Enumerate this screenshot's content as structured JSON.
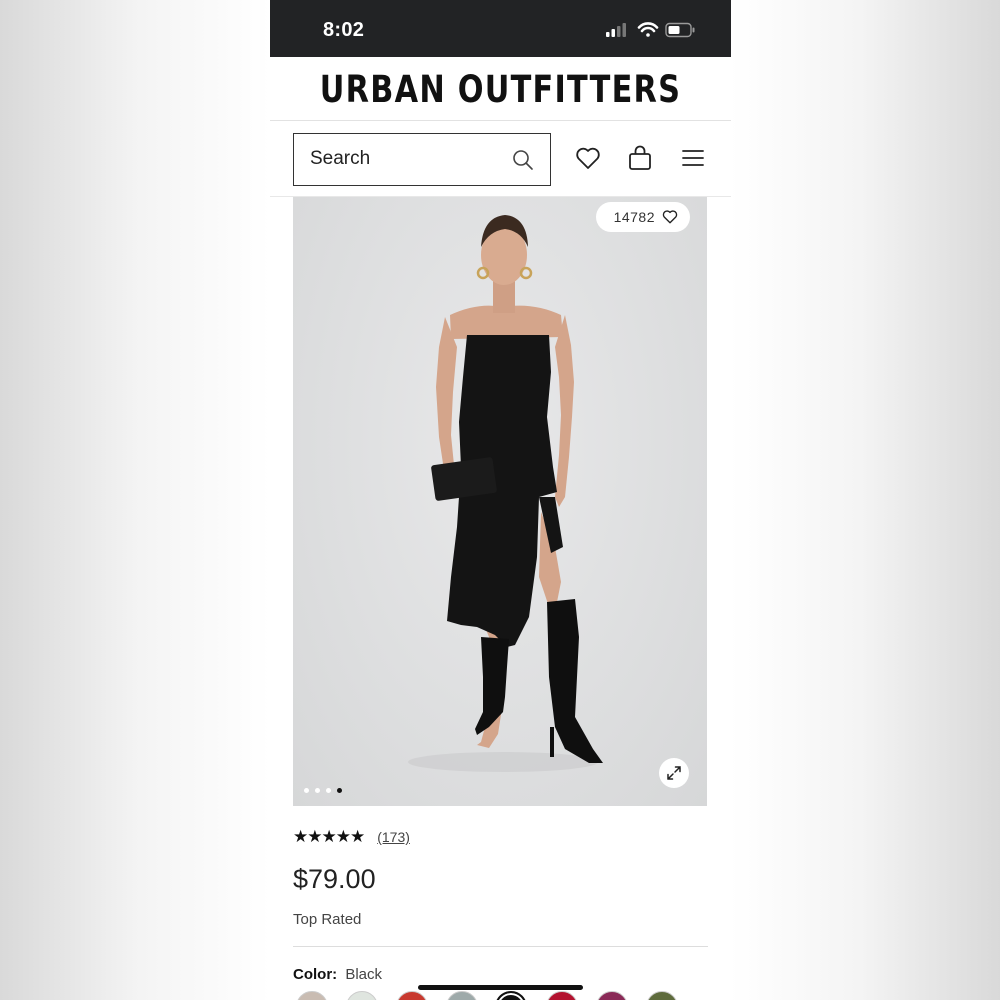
{
  "status_bar": {
    "time": "8:02",
    "icons": [
      "signal-icon",
      "wifi-icon",
      "battery-icon"
    ]
  },
  "header": {
    "brand": "URBAN OUTFITTERS"
  },
  "search": {
    "placeholder": "Search",
    "icon": "search-icon"
  },
  "header_actions": [
    "heart-icon",
    "bag-icon",
    "menu-icon"
  ],
  "product": {
    "likes": "14782",
    "image_count": 4,
    "active_image_index": 3,
    "rating": {
      "stars": "★★★★★",
      "score": 5,
      "count": "(173)"
    },
    "price": "$79.00",
    "badge": "Top Rated",
    "color_label": "Color:",
    "color_value": "Black"
  },
  "swatches": [
    {
      "name": "taupe",
      "color": "#c9bcb2"
    },
    {
      "name": "sage",
      "color": "#dfe5df"
    },
    {
      "name": "red-print",
      "color": "#c8392f"
    },
    {
      "name": "grey-blue",
      "color": "#9eaaaa"
    },
    {
      "name": "black",
      "color": "#111111",
      "selected": true
    },
    {
      "name": "crimson",
      "color": "#b3122f"
    },
    {
      "name": "plum",
      "color": "#8a2a57"
    },
    {
      "name": "olive",
      "color": "#5e6b3c"
    }
  ],
  "colors": {
    "status_bar_bg": "#222325",
    "text_primary": "#111111",
    "image_bg": "#dedfe0"
  }
}
